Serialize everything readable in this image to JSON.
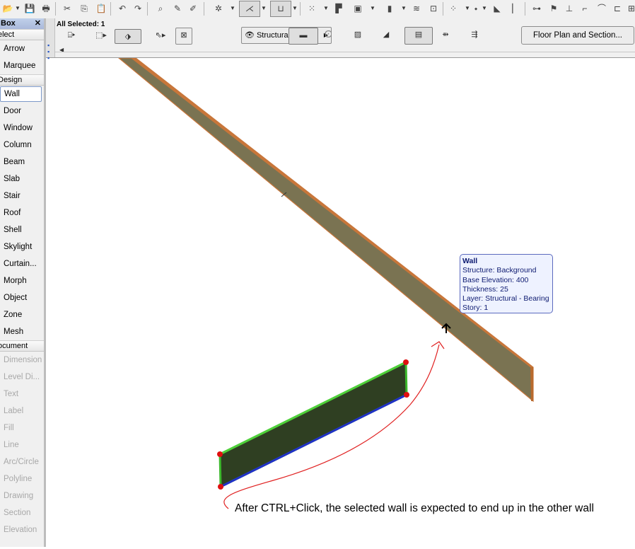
{
  "toolbar": {
    "icons": [
      "open-icon",
      "save-icon",
      "print-icon",
      "cut-icon",
      "copy-icon",
      "paste-icon",
      "undo-icon",
      "redo-icon",
      "find-select-icon",
      "eyedropper-icon",
      "syringe-icon",
      "magic-wand-icon",
      "snap-guides-icon",
      "gravity-icon",
      "grid-snap-icon",
      "trim-icon",
      "intersect-icon",
      "adjust-icon",
      "split-icon",
      "elevation-dimension-icon",
      "dimension-icon",
      "drag-icon",
      "rotate-icon",
      "mirror-icon",
      "elevate-icon",
      "fillet-icon",
      "offset-icon"
    ]
  },
  "infobox": {
    "selection": "All Selected: 1",
    "layer": "Structural - Be...",
    "floor_plan_section": "Floor Plan and Section..."
  },
  "toolbox": {
    "title": "Box",
    "close": "✕",
    "sections": {
      "select": "elect",
      "design": "Design",
      "document": "ocument"
    },
    "select_tools": [
      "Arrow",
      "Marquee"
    ],
    "design_tools": [
      "Wall",
      "Door",
      "Window",
      "Column",
      "Beam",
      "Slab",
      "Stair",
      "Roof",
      "Shell",
      "Skylight",
      "Curtain...",
      "Morph",
      "Object",
      "Zone",
      "Mesh"
    ],
    "document_tools": [
      "Dimension",
      "Level Di...",
      "Text",
      "Label",
      "Fill",
      "Line",
      "Arc/Circle",
      "Polyline",
      "Drawing",
      "Section",
      "Elevation"
    ],
    "active_tool": "Wall"
  },
  "tooltip": {
    "title": "Wall",
    "structure": "Structure: Background",
    "elevation": "Base Elevation: 400",
    "thickness": "Thickness: 25",
    "layer": "Layer: Structural - Bearing",
    "story": "Story: 1"
  },
  "annotation": "After CTRL+Click, the selected wall is expected to end up in the other wall",
  "colors": {
    "wall_fill": "#77704f",
    "wall_edge": "#c8763a",
    "selected_fill": "#2f3f22",
    "selected_edge": "#3cb82c",
    "selected_base": "#2030c8",
    "handle": "#e01010",
    "arrow": "#e02020",
    "tooltip_bg": "#eef2ff",
    "tooltip_border": "#5b6abf"
  }
}
